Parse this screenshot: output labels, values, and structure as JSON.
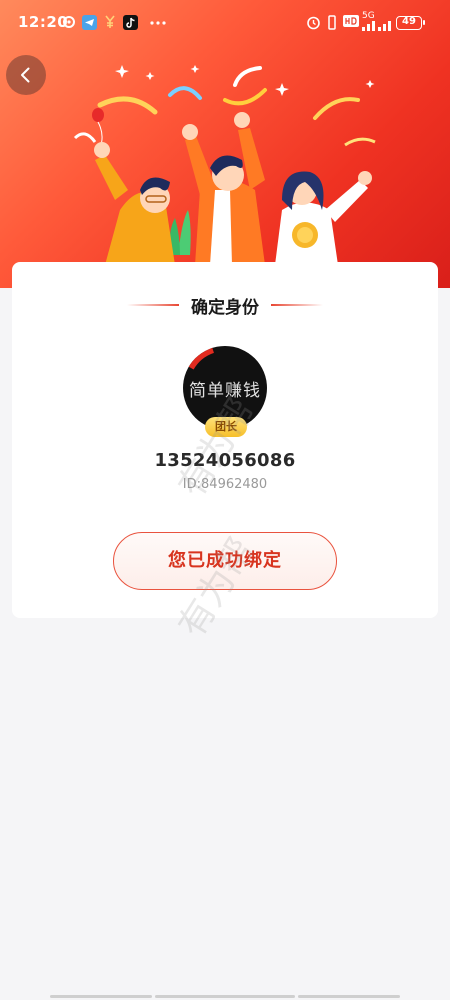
{
  "status_bar": {
    "time": "12:20",
    "network": "5G",
    "battery": "49"
  },
  "header": {
    "back_icon": "chevron-left-icon"
  },
  "card": {
    "title": "确定身份",
    "avatar_text": "简单赚钱",
    "role_badge": "团长",
    "phone": "13524056086",
    "user_id": "ID:84962480",
    "action_label": "您已成功绑定"
  },
  "watermark": {
    "text": "有为帮"
  },
  "colors": {
    "accent": "#e84632",
    "button_text": "#d8341f",
    "banner_start": "#ff8a5c",
    "banner_end": "#d91f1a",
    "badge": "#f6bf2a"
  }
}
